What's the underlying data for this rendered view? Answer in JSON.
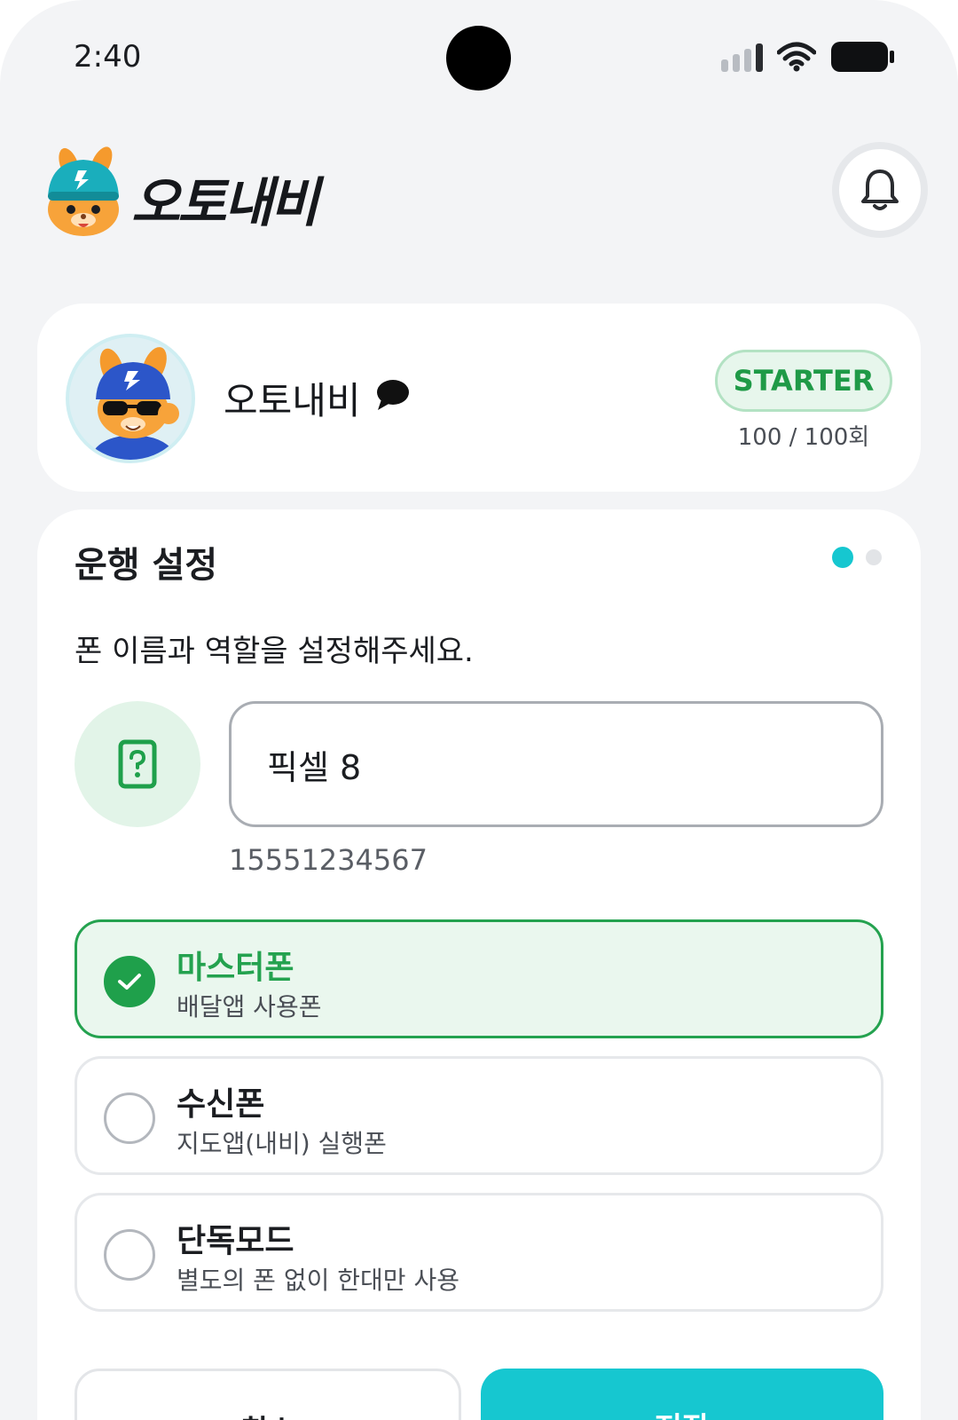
{
  "status_bar": {
    "time": "2:40"
  },
  "header": {
    "brand": "오토내비"
  },
  "profile": {
    "name": "오토내비",
    "plan": "STARTER",
    "usage": "100 / 100회"
  },
  "settings": {
    "title": "운행 설정",
    "instruction": "폰 이름과 역할을 설정해주세요.",
    "phone_name_value": "픽셀 8",
    "phone_number": "15551234567",
    "roles": [
      {
        "title": "마스터폰",
        "desc": "배달앱 사용폰",
        "selected": true
      },
      {
        "title": "수신폰",
        "desc": "지도앱(내비) 실행폰",
        "selected": false
      },
      {
        "title": "단독모드",
        "desc": "별도의 폰 없이 한대만 사용",
        "selected": false
      }
    ],
    "cancel_label": "취소",
    "save_label": "저장"
  },
  "colors": {
    "accent": "#16c7d0",
    "selected_green": "#24a24f",
    "badge_bg": "#e7f6ec"
  },
  "icons": [
    "bell-icon",
    "chat-bubble-icon",
    "phone-question-icon",
    "check-icon"
  ]
}
